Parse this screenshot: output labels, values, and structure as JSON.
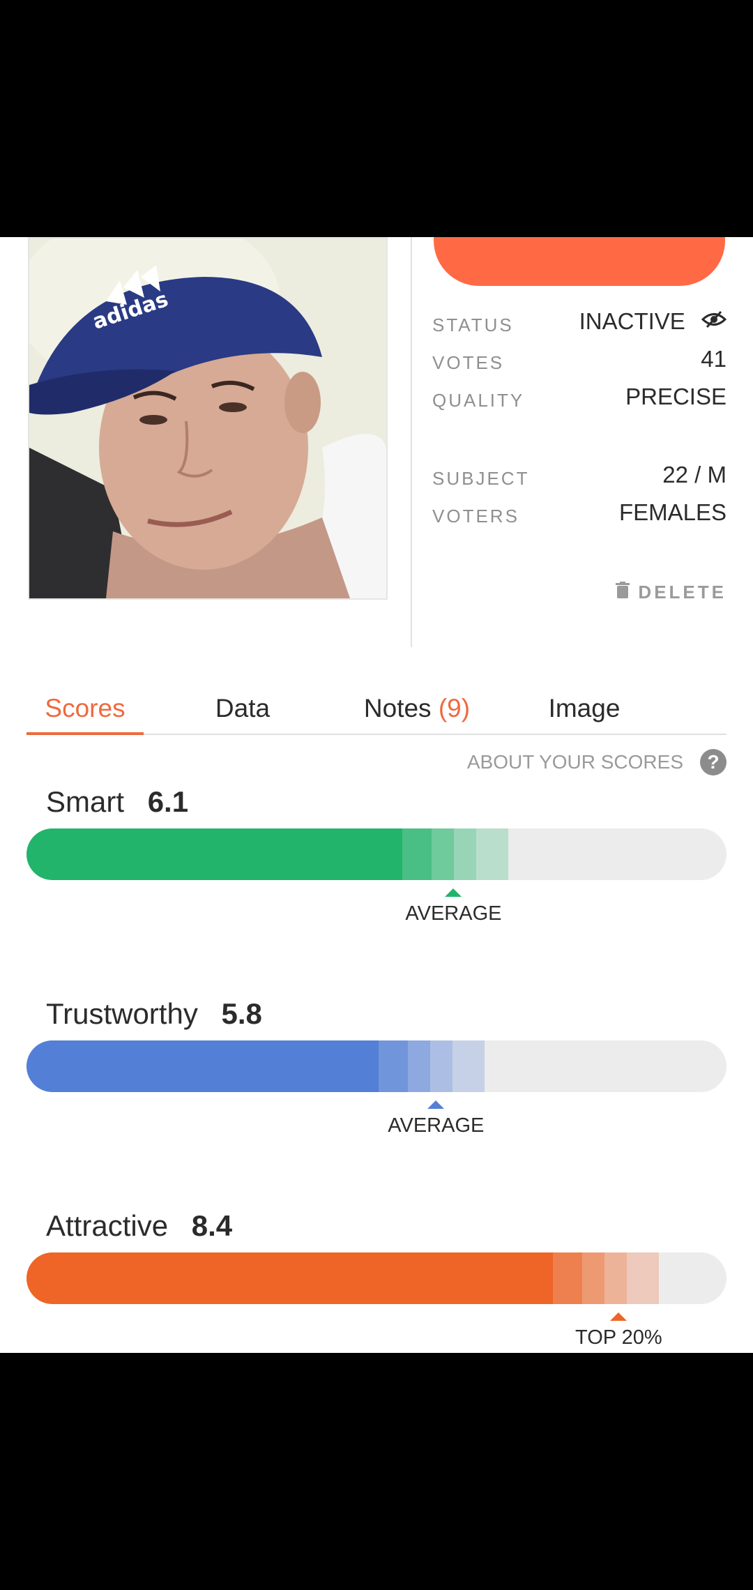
{
  "profile": {
    "status_label": "STATUS",
    "status_value": "INACTIVE",
    "votes_label": "VOTES",
    "votes_value": "41",
    "quality_label": "QUALITY",
    "quality_value": "PRECISE",
    "subject_label": "SUBJECT",
    "subject_value": "22 / M",
    "voters_label": "VOTERS",
    "voters_value": "FEMALES",
    "delete_label": "DELETE"
  },
  "tabs": {
    "scores": "Scores",
    "data": "Data",
    "notes_label": "Notes",
    "notes_count": "(9)",
    "image": "Image"
  },
  "about": {
    "label": "ABOUT YOUR SCORES",
    "help_symbol": "?"
  },
  "scores": {
    "smart": {
      "label": "Smart",
      "value": "6.1",
      "marker_label": "AVERAGE",
      "color": "#22b46b",
      "fill_fraction": 0.537,
      "marker_fraction": 0.61
    },
    "trustworthy": {
      "label": "Trustworthy",
      "value": "5.8",
      "marker_label": "AVERAGE",
      "color": "#537fd6",
      "fill_fraction": 0.503,
      "marker_fraction": 0.585
    },
    "attractive": {
      "label": "Attractive",
      "value": "8.4",
      "marker_label": "TOP 20%",
      "color": "#ee6527",
      "fill_fraction": 0.752,
      "marker_fraction": 0.846
    }
  },
  "colors": {
    "accent": "#ee6a3f",
    "top_button": "#ff6a45"
  }
}
